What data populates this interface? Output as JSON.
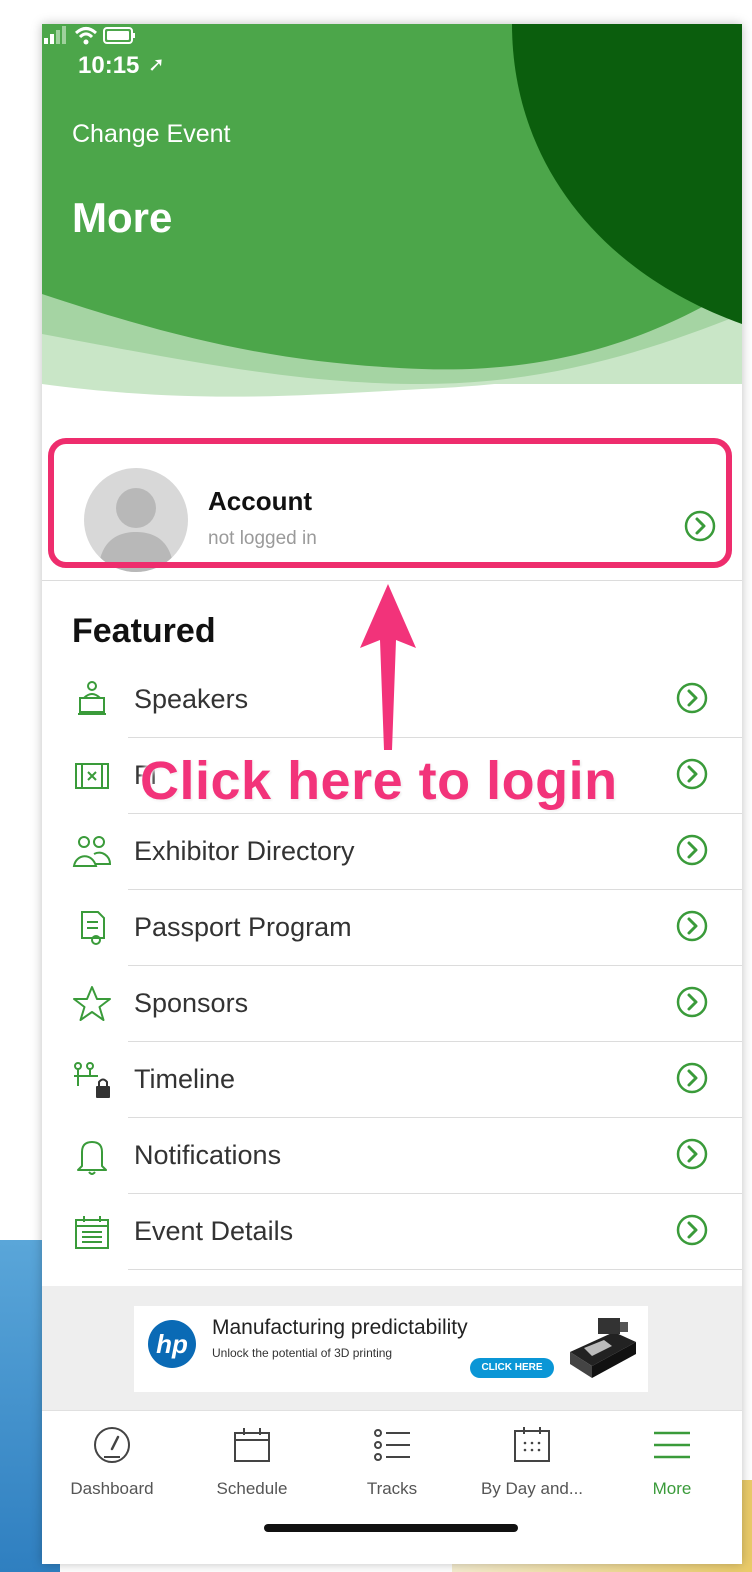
{
  "status_bar": {
    "time": "10:15"
  },
  "header": {
    "change_event": "Change Event",
    "title": "More"
  },
  "colors": {
    "accent": "#3a9b3a",
    "highlight": "#ee2d6d",
    "header_light": "#4ca64a",
    "header_dark": "#0b5e0d"
  },
  "account": {
    "title": "Account",
    "subtitle": "not logged in"
  },
  "annotation": {
    "text": "Click here to login"
  },
  "featured": {
    "heading": "Featured",
    "items": [
      {
        "label": "Speakers",
        "icon": "speaker-podium-icon"
      },
      {
        "label": "Fl",
        "icon": "floor-map-icon"
      },
      {
        "label": "Exhibitor Directory",
        "icon": "people-icon"
      },
      {
        "label": "Passport Program",
        "icon": "passport-certificate-icon"
      },
      {
        "label": "Sponsors",
        "icon": "star-icon"
      },
      {
        "label": "Timeline",
        "icon": "timeline-lock-icon"
      },
      {
        "label": "Notifications",
        "icon": "bell-icon"
      },
      {
        "label": "Event Details",
        "icon": "calendar-details-icon"
      }
    ]
  },
  "ad": {
    "logo": "hp",
    "title": "Manufacturing predictability",
    "subtitle": "Unlock the potential of 3D printing",
    "button": "CLICK HERE"
  },
  "tabs": [
    {
      "label": "Dashboard",
      "icon": "gauge-icon"
    },
    {
      "label": "Schedule",
      "icon": "calendar-icon"
    },
    {
      "label": "Tracks",
      "icon": "list-icon"
    },
    {
      "label": "By Day and...",
      "icon": "calendar-grid-icon"
    },
    {
      "label": "More",
      "icon": "menu-icon",
      "active": true
    }
  ]
}
